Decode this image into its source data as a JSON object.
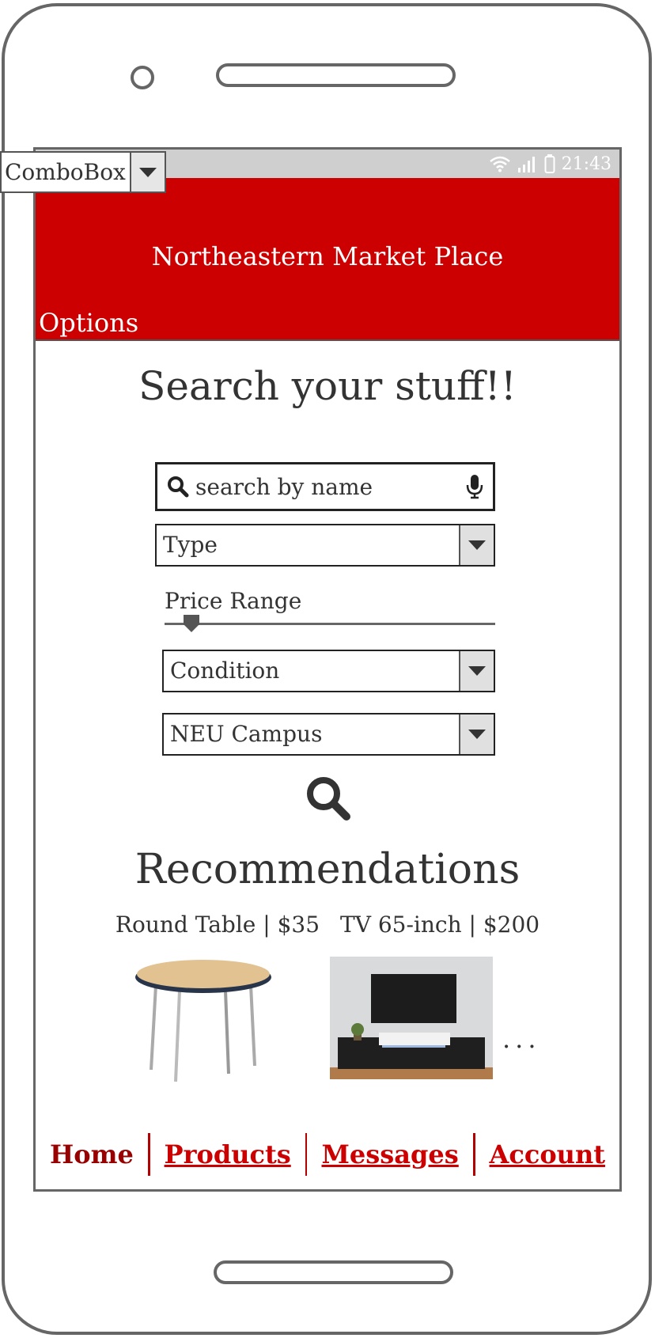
{
  "status_bar": {
    "time": "21:43"
  },
  "combobox": {
    "label": "ComboBox"
  },
  "header": {
    "title": "Northeastern Market Place",
    "options_label": "Options"
  },
  "search": {
    "title": "Search your stuff!!",
    "placeholder": "search by name",
    "type_value": "Type",
    "price_label": "Price Range",
    "price_slider_fraction": 0.06,
    "condition_value": "Condition",
    "campus_value": "NEU Campus"
  },
  "recommendations": {
    "title": "Recommendations",
    "items": [
      {
        "label": "Round Table | $35"
      },
      {
        "label": "TV 65-inch | $200"
      }
    ],
    "more": "..."
  },
  "nav": {
    "items": [
      {
        "label": "Home",
        "active": true
      },
      {
        "label": "Products",
        "active": false
      },
      {
        "label": "Messages",
        "active": false
      },
      {
        "label": "Account",
        "active": false
      }
    ]
  },
  "colors": {
    "brand_red": "#cc0000",
    "nav_active": "#990000"
  }
}
